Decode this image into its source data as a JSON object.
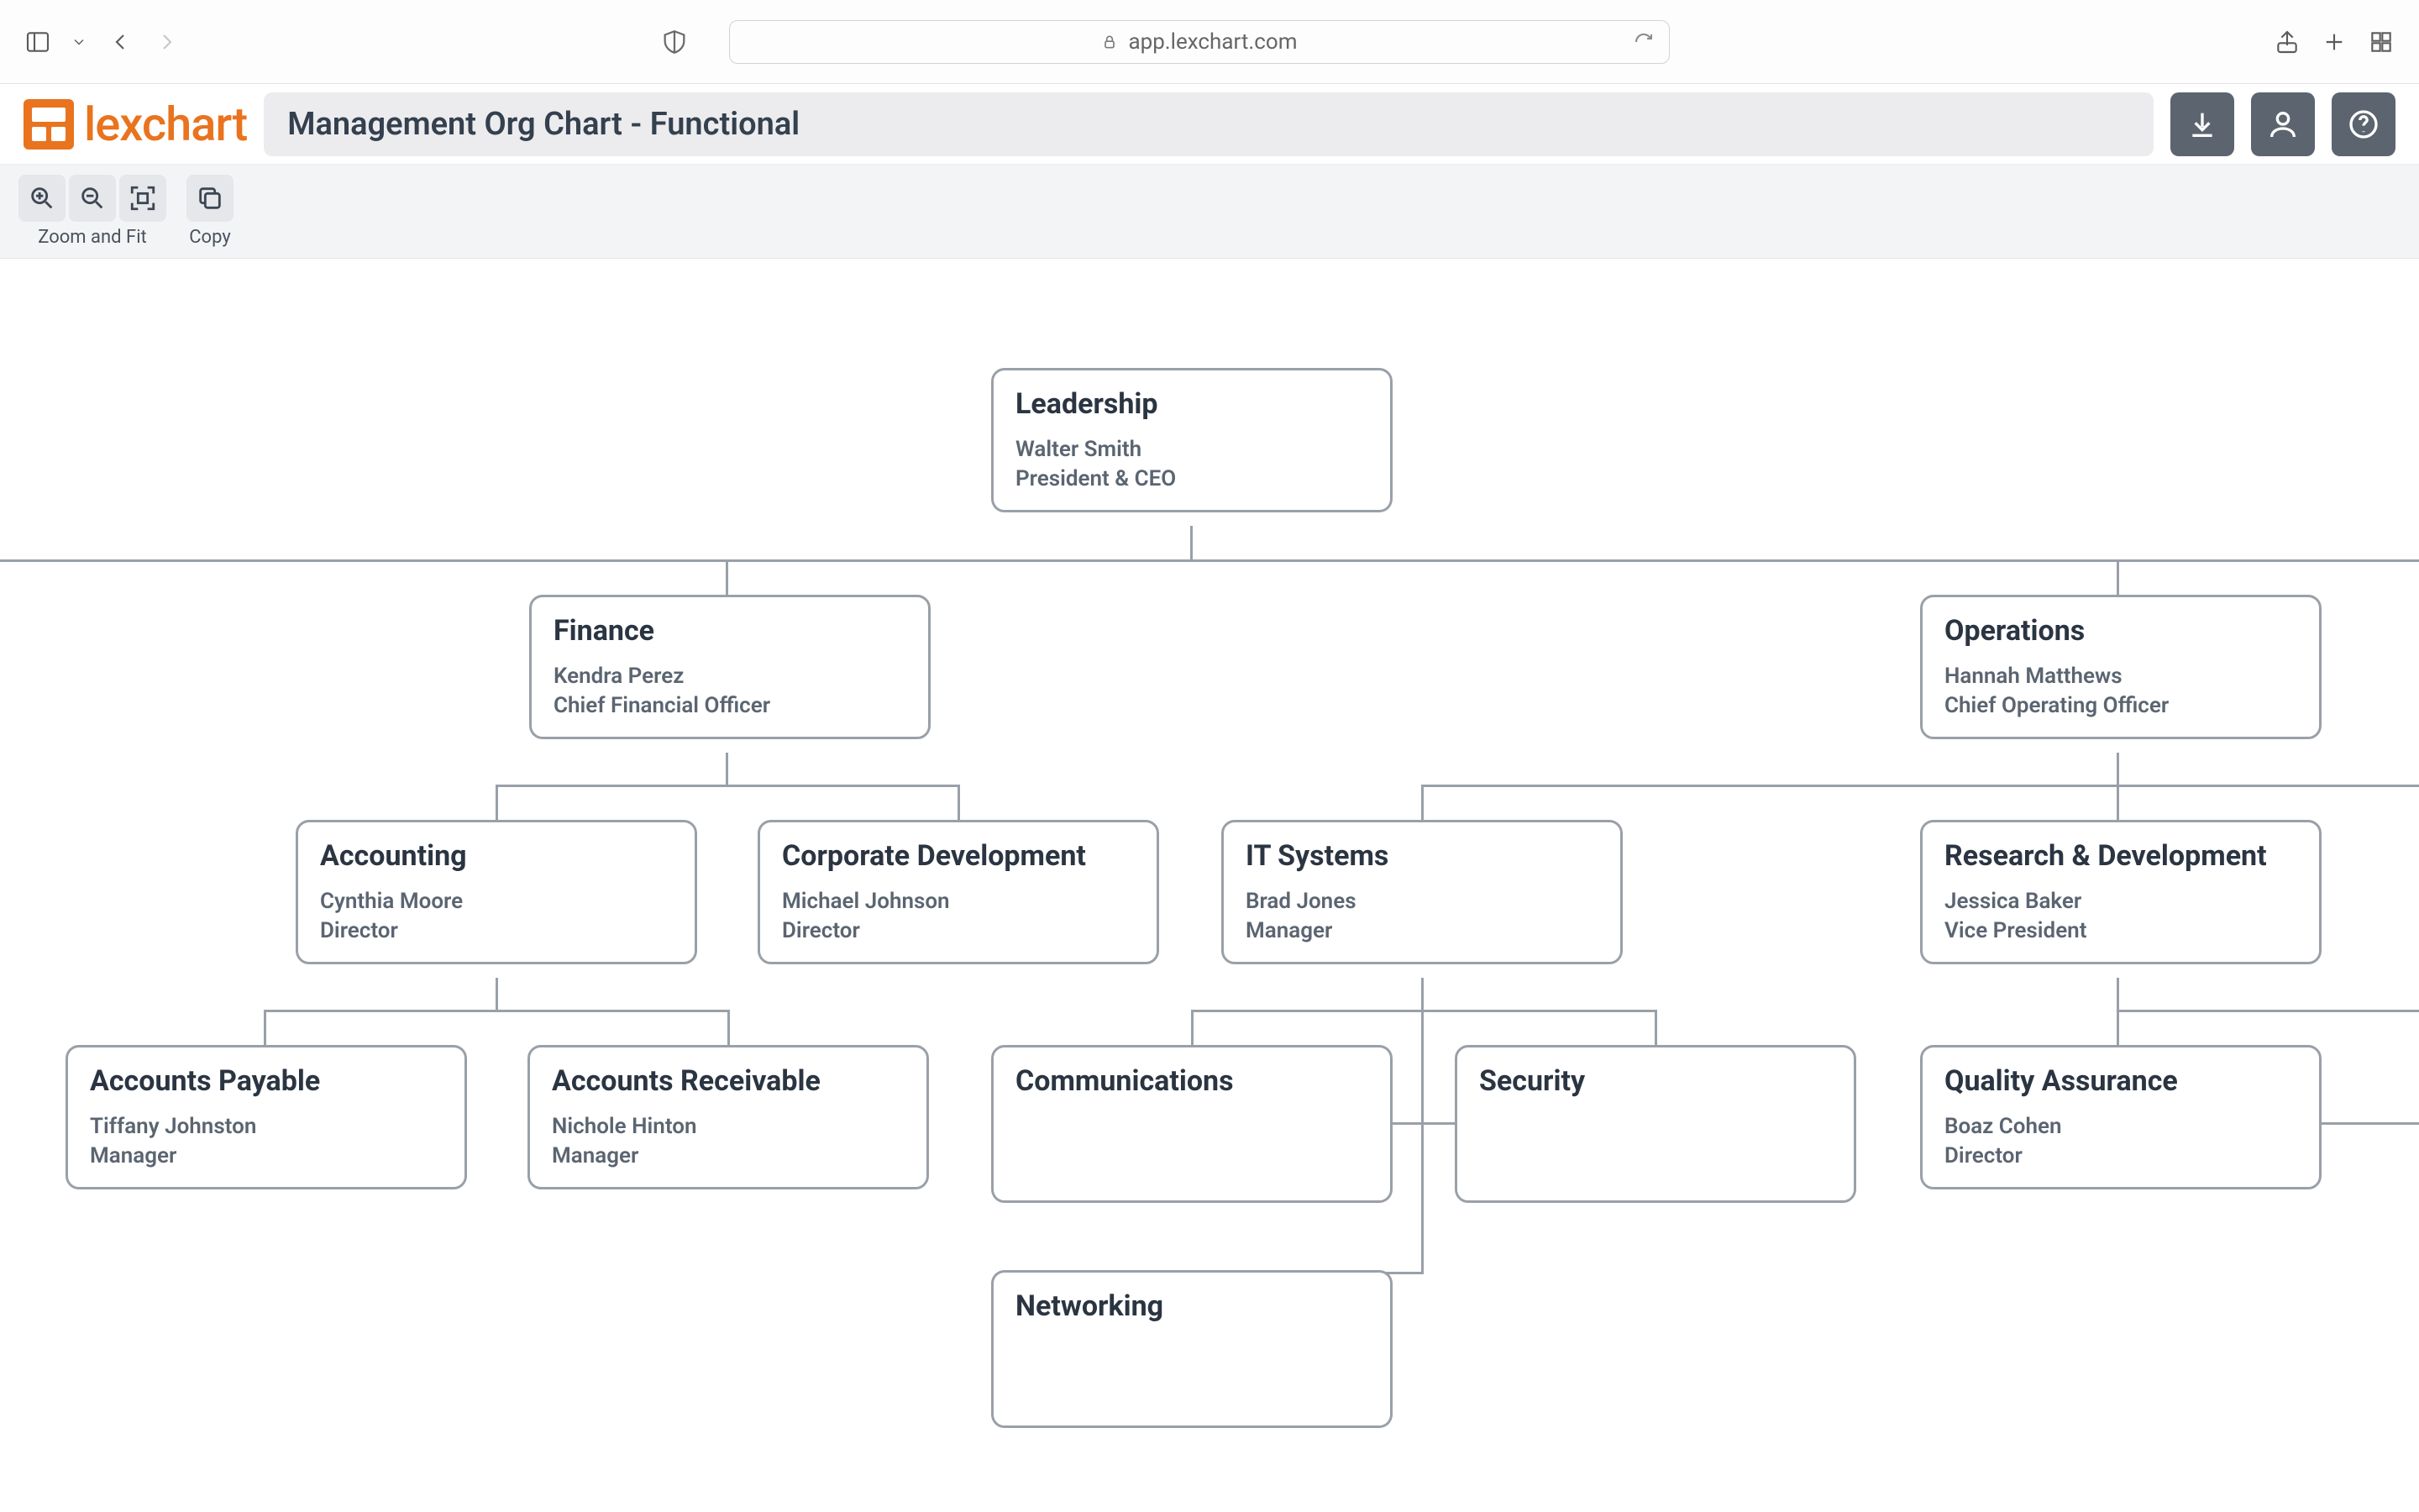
{
  "browser": {
    "url": "app.lexchart.com"
  },
  "app": {
    "brand": "lexchart",
    "chart_title": "Management Org Chart - Functional"
  },
  "toolbar": {
    "zoom_group_label": "Zoom and Fit",
    "copy_group_label": "Copy"
  },
  "org": {
    "leadership": {
      "dept": "Leadership",
      "person": "Walter Smith",
      "role": "President & CEO"
    },
    "finance": {
      "dept": "Finance",
      "person": "Kendra Perez",
      "role": "Chief Financial Officer"
    },
    "operations": {
      "dept": "Operations",
      "person": "Hannah Matthews",
      "role": "Chief Operating Officer"
    },
    "accounting": {
      "dept": "Accounting",
      "person": "Cynthia Moore",
      "role": "Director"
    },
    "corp_dev": {
      "dept": "Corporate Development",
      "person": "Michael Johnson",
      "role": "Director"
    },
    "it_systems": {
      "dept": "IT Systems",
      "person": "Brad Jones",
      "role": "Manager"
    },
    "rnd": {
      "dept": "Research & Development",
      "person": "Jessica Baker",
      "role": "Vice President"
    },
    "ap": {
      "dept": "Accounts Payable",
      "person": "Tiffany Johnston",
      "role": "Manager"
    },
    "ar": {
      "dept": "Accounts Receivable",
      "person": "Nichole Hinton",
      "role": "Manager"
    },
    "comms": {
      "dept": "Communications"
    },
    "security": {
      "dept": "Security"
    },
    "networking": {
      "dept": "Networking"
    },
    "qa": {
      "dept": "Quality Assurance",
      "person": "Boaz Cohen",
      "role": "Director"
    }
  }
}
